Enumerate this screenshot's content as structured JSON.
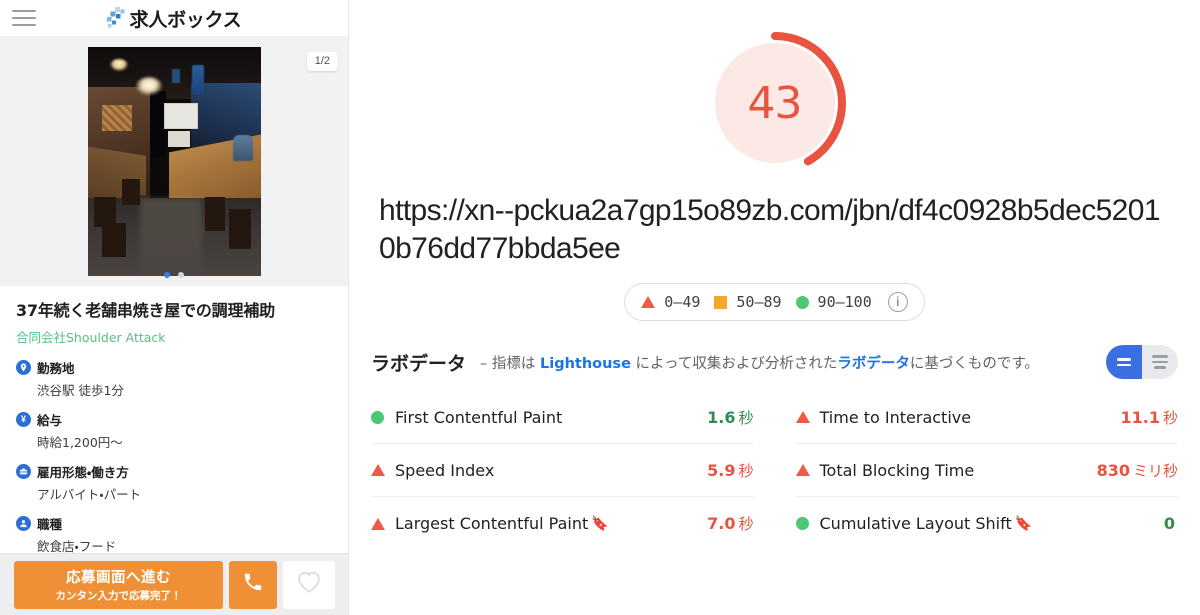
{
  "left_panel": {
    "header": {
      "menu_icon": "hamburger-icon",
      "logo_text": "求人ボックス"
    },
    "carousel": {
      "counter": "1/2",
      "image_alt": "izakaya-interior-photo",
      "dots": [
        {
          "active": true
        },
        {
          "active": false
        }
      ]
    },
    "job": {
      "title": "37年続く老舗串焼き屋での調理補助",
      "company": "合同会社Shoulder Attack",
      "details": [
        {
          "icon": "location-pin-icon",
          "label": "勤務地",
          "value": "渋谷駅 徒歩1分"
        },
        {
          "icon": "yen-icon",
          "label": "給与",
          "value": "時給1,200円〜"
        },
        {
          "icon": "briefcase-icon",
          "label": "雇用形態・働き方",
          "value": "アルバイト・パート"
        },
        {
          "icon": "person-icon",
          "label": "職種",
          "value": "飲食店・フード"
        }
      ]
    },
    "actions": {
      "apply_main": "応募画面へ進む",
      "apply_sub": "カンタン入力で応募完了！",
      "tel_icon": "phone-icon",
      "fav_icon": "heart-icon",
      "accent_color": "#f09036"
    }
  },
  "report": {
    "score": {
      "value": "43",
      "percent": 43,
      "color": "#e8543f",
      "track_color": "#fce9e6"
    },
    "url": "https://xn--pckua2a7gp15o89zb.com/jbn/df4c0928b5dec52010b76dd77bbda5ee",
    "legend": {
      "items": [
        {
          "shape": "triangle",
          "label": "0–49",
          "color": "#ef5a48"
        },
        {
          "shape": "square",
          "label": "50–89",
          "color": "#f6a72b"
        },
        {
          "shape": "circle",
          "label": "90–100",
          "color": "#4dc773"
        }
      ],
      "info_icon": "info-icon"
    },
    "lab_data": {
      "title": "ラボデータ",
      "desc_dash": "–",
      "desc_part1": "指標は ",
      "desc_link1": "Lighthouse",
      "desc_part2": " によって収集および分析された",
      "desc_link2": "ラボデータ",
      "desc_part3": "に基づくものです。",
      "toggle": {
        "active_view": "grid-view",
        "idle_view": "list-view"
      }
    },
    "metrics": [
      {
        "status": "green",
        "name": "First Contentful Paint",
        "flag": false,
        "value": "1.6",
        "unit": "秒",
        "value_color": "green"
      },
      {
        "status": "red",
        "name": "Time to Interactive",
        "flag": false,
        "value": "11.1",
        "unit": "秒",
        "value_color": "red"
      },
      {
        "status": "red",
        "name": "Speed Index",
        "flag": false,
        "value": "5.9",
        "unit": "秒",
        "value_color": "red"
      },
      {
        "status": "red",
        "name": "Total Blocking Time",
        "flag": false,
        "value": "830",
        "unit": "ミリ秒",
        "value_color": "red"
      },
      {
        "status": "red",
        "name": "Largest Contentful Paint",
        "flag": true,
        "value": "7.0",
        "unit": "秒",
        "value_color": "red"
      },
      {
        "status": "green",
        "name": "Cumulative Layout Shift",
        "flag": true,
        "value": "0",
        "unit": "",
        "value_color": "green"
      }
    ]
  }
}
